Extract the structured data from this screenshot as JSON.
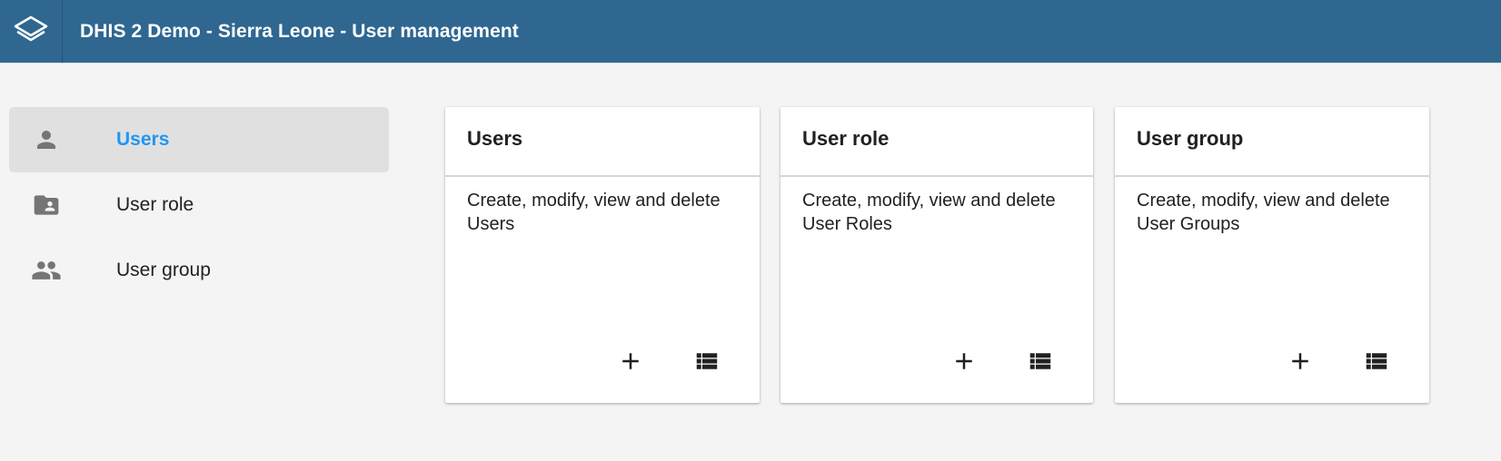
{
  "header": {
    "title": "DHIS 2 Demo - Sierra Leone - User management",
    "logo_icon": "dhis2-layers-icon",
    "background": "#2f6791"
  },
  "sidebar": {
    "items": [
      {
        "label": "Users",
        "icon": "person-icon",
        "active": true
      },
      {
        "label": "User role",
        "icon": "folder-shared-icon",
        "active": false
      },
      {
        "label": "User group",
        "icon": "people-icon",
        "active": false
      }
    ],
    "active_color": "#2196f3"
  },
  "cards": [
    {
      "title": "Users",
      "description": "Create, modify, view and delete Users",
      "add_icon": "add-icon",
      "list_icon": "list-icon"
    },
    {
      "title": "User role",
      "description": "Create, modify, view and delete User Roles",
      "add_icon": "add-icon",
      "list_icon": "list-icon"
    },
    {
      "title": "User group",
      "description": "Create, modify, view and delete User Groups",
      "add_icon": "add-icon",
      "list_icon": "list-icon"
    }
  ]
}
